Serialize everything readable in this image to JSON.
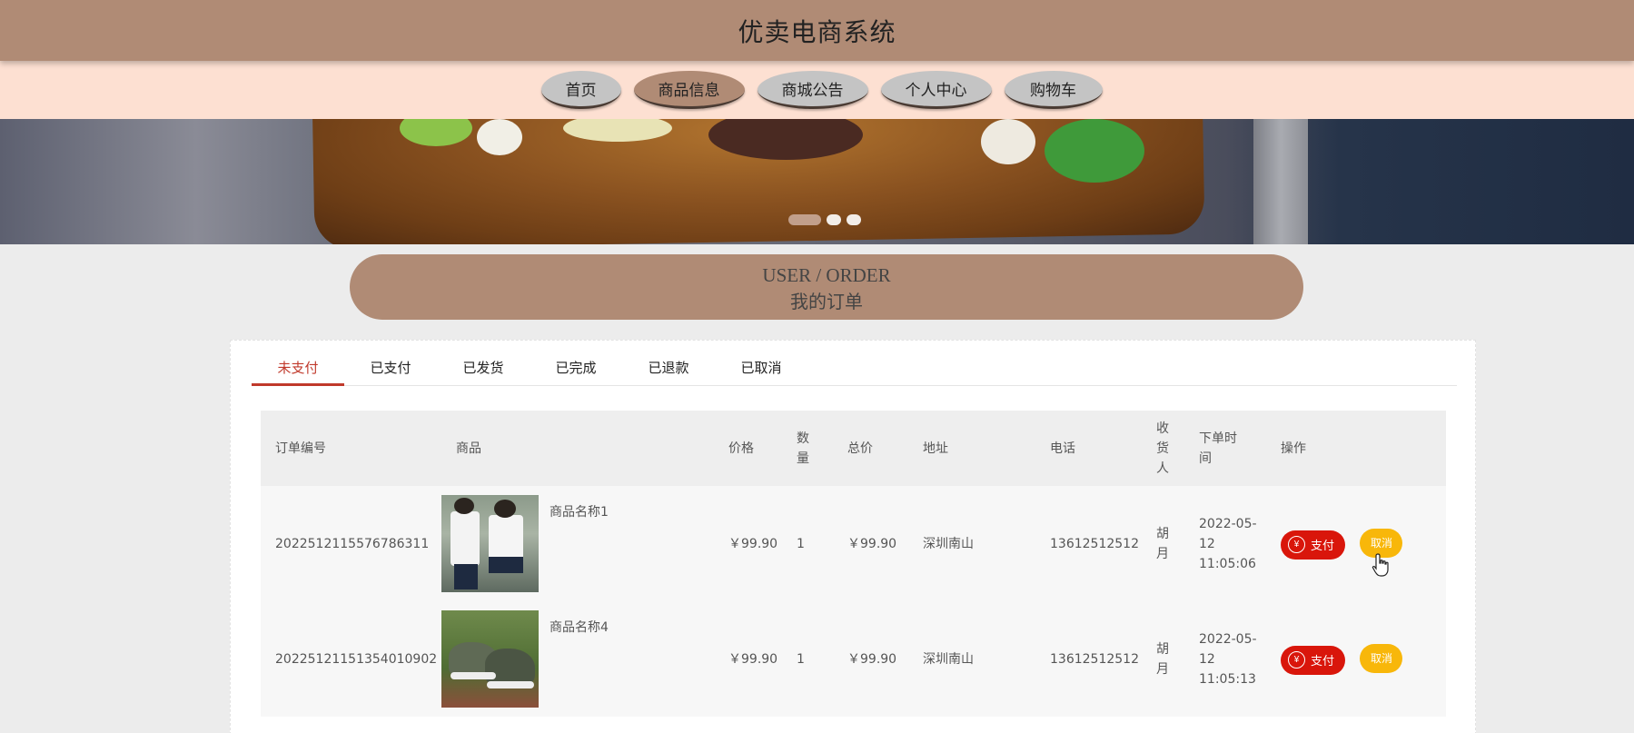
{
  "header": {
    "title": "优卖电商系统"
  },
  "nav": {
    "items": [
      {
        "label": "首页",
        "active": false
      },
      {
        "label": "商品信息",
        "active": true
      },
      {
        "label": "商城公告",
        "active": false
      },
      {
        "label": "个人中心",
        "active": false
      },
      {
        "label": "购物车",
        "active": false
      }
    ]
  },
  "banner": {
    "slide_count": 3,
    "active_slide": 1
  },
  "section": {
    "title_en": "USER / ORDER",
    "title_cn": "我的订单"
  },
  "tabs": [
    {
      "label": "未支付",
      "active": true
    },
    {
      "label": "已支付",
      "active": false
    },
    {
      "label": "已发货",
      "active": false
    },
    {
      "label": "已完成",
      "active": false
    },
    {
      "label": "已退款",
      "active": false
    },
    {
      "label": "已取消",
      "active": false
    }
  ],
  "table": {
    "headers": {
      "order_no": "订单编号",
      "goods": "商品",
      "price": "价格",
      "qty": "数量",
      "total": "总价",
      "address": "地址",
      "phone": "电话",
      "receiver": "收货人",
      "time": "下单时间",
      "actions": "操作"
    },
    "rows": [
      {
        "order_no": "2022512115576786311",
        "goods_name": "商品名称1",
        "goods_image_icon": "school-uniform-photo",
        "price": "￥99.90",
        "qty": "1",
        "total": "￥99.90",
        "address": "深圳南山",
        "phone": "13612512512",
        "receiver": "胡月",
        "time": "2022-05-12 11:05:06",
        "pay_label": "支付",
        "cancel_label": "取消"
      },
      {
        "order_no": "20225121151354010902",
        "goods_name": "商品名称4",
        "goods_image_icon": "camo-shoes-photo",
        "price": "￥99.90",
        "qty": "1",
        "total": "￥99.90",
        "address": "深圳南山",
        "phone": "13612512512",
        "receiver": "胡月",
        "time": "2022-05-12 11:05:13",
        "pay_label": "支付",
        "cancel_label": "取消"
      }
    ]
  },
  "colors": {
    "header": "#b08b75",
    "nav_bg": "#fde0d2",
    "tab_active": "#c0392b",
    "pay_button": "#d9160b",
    "cancel_button": "#f8b70a"
  }
}
